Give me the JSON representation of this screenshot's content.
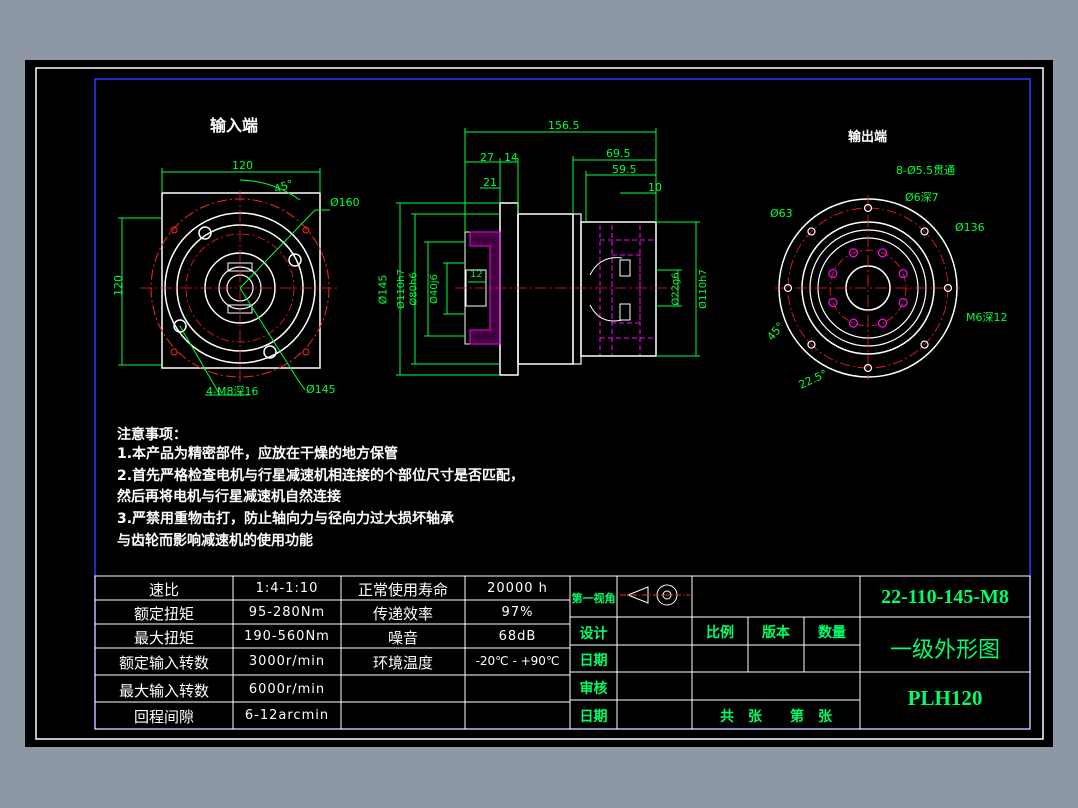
{
  "views": {
    "input_label": "输入端",
    "output_label": "输出端"
  },
  "dims": {
    "in_120_top": "120",
    "in_120_side": "120",
    "in_45": "45°",
    "in_160": "Ø160",
    "in_145": "Ø145",
    "in_holes": "4-M8深16",
    "side_1565": "156.5",
    "side_27": "27",
    "side_14": "14",
    "side_695": "69.5",
    "side_595": "59.5",
    "side_21": "21",
    "side_10": "10",
    "side_12": "12",
    "side_d145": "Ø145",
    "side_d110": "Ø110h7",
    "side_d80": "Ø80h6",
    "side_d40": "Ø40j6",
    "side_d22": "Ø22g6",
    "side_d110b": "Ø110h7",
    "out_holes8": "8-Ø5.5贯通",
    "out_d6": "Ø6深7",
    "out_d63": "Ø63",
    "out_d136": "Ø136",
    "out_m6": "M6深12",
    "out_45": "45°",
    "out_225": "22.5°"
  },
  "notes": {
    "title": "注意事项：",
    "line1": "1.本产品为精密部件，应放在干燥的地方保管",
    "line2": "2.首先严格检查电机与行星减速机相连接的个部位尺寸是否匹配，",
    "line3": "然后再将电机与行星减速机自然连接",
    "line4": "3.严禁用重物击打，防止轴向力与径向力过大损坏轴承",
    "line5": "与齿轮而影响减速机的使用功能"
  },
  "specs": [
    {
      "label": "速比",
      "value": "1:4-1:10",
      "label2": "正常使用寿命",
      "value2": "20000 h"
    },
    {
      "label": "额定扭矩",
      "value": "95-280Nm",
      "label2": "传递效率",
      "value2": "97%"
    },
    {
      "label": "最大扭矩",
      "value": "190-560Nm",
      "label2": "噪音",
      "value2": "68dB"
    },
    {
      "label": "额定输入转数",
      "value": "3000r/min",
      "label2": "环境温度",
      "value2": "-20℃ - +90℃"
    },
    {
      "label": "最大输入转数",
      "value": "6000r/min",
      "label2": "",
      "value2": ""
    },
    {
      "label": "回程间隙",
      "value": "6-12arcmin",
      "label2": "",
      "value2": ""
    }
  ],
  "titleblock": {
    "first_angle": "第一视角",
    "design": "设计",
    "date1": "日期",
    "review": "审核",
    "date2": "日期",
    "scale": "比例",
    "version": "版本",
    "quantity": "数量",
    "total_sheets": "共　张　　第　张",
    "part_no": "22-110-145-M8",
    "drawing_name": "一级外形图",
    "model": "PLH120"
  },
  "colors": {
    "background": "#000000",
    "frame_outer": "#ffffff",
    "frame_blue": "#1e2cff",
    "dimension": "#00ff3c",
    "center_red": "#ff2222",
    "hidden_magenta": "#ff00ff",
    "titleblock_text": "#00ff66"
  }
}
